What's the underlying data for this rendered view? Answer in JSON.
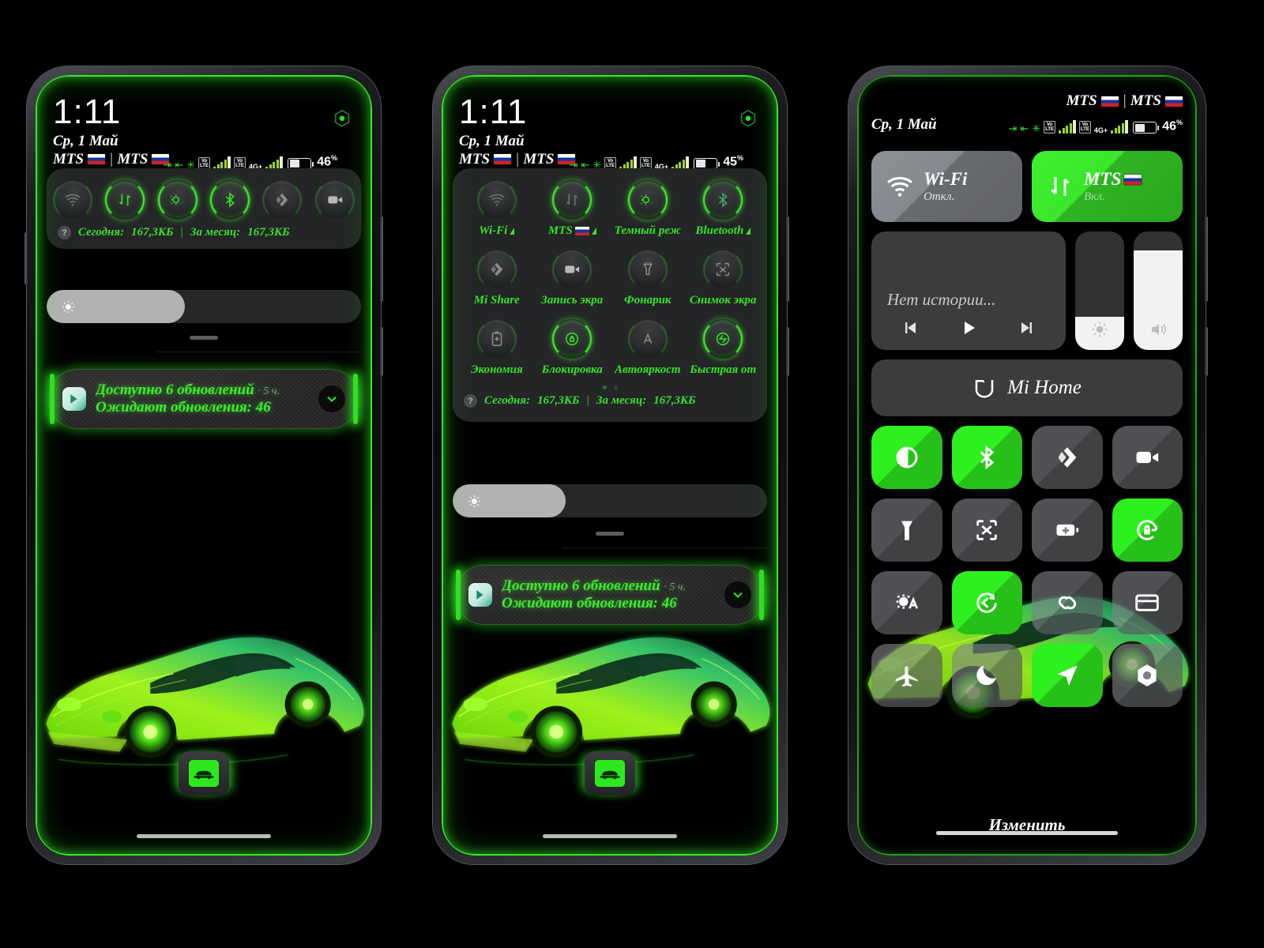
{
  "status_bar": {
    "time": "1:11",
    "date": "Ср, 1 Май",
    "carrier_1": "MTS",
    "carrier_2": "MTS",
    "carrier_separator": "|",
    "network_type": "4G+",
    "volte_label": "VoLTE",
    "battery_phone1": "46",
    "battery_phone2": "45",
    "battery_phone3": "46",
    "percent_symbol": "%"
  },
  "phone1": {
    "quick_toggles": [
      {
        "name": "wifi-toggle",
        "icon": "wifi-icon",
        "state": "off"
      },
      {
        "name": "mobile-data-toggle",
        "icon": "mobile-data-icon",
        "state": "on"
      },
      {
        "name": "dark-mode-toggle",
        "icon": "dark-mode-icon",
        "state": "on"
      },
      {
        "name": "bluetooth-toggle",
        "icon": "bluetooth-icon",
        "state": "on"
      },
      {
        "name": "mi-share-toggle",
        "icon": "mi-share-icon",
        "state": "off"
      },
      {
        "name": "screen-record-toggle",
        "icon": "screen-record-icon",
        "state": "off"
      }
    ],
    "data_usage": {
      "today_label": "Сегодня:",
      "today_value": "167,3КБ",
      "month_label": "За месяц:",
      "month_value": "167,3КБ",
      "help_glyph": "?"
    },
    "brightness_percent": 44,
    "notification": {
      "line1": "Доступно 6 обновлений",
      "age": "· 5 ч.",
      "line2": "Ожидают обновления: 46",
      "app_icon": "play-store-icon",
      "expand_icon": "chevron-down-icon"
    },
    "dock_app": "car-app-icon"
  },
  "phone2": {
    "tiles": [
      {
        "label": "Wi-Fi",
        "icon": "wifi-icon",
        "state": "off",
        "has_caret": true,
        "flag": false
      },
      {
        "label": "MTS",
        "icon": "mobile-data-icon",
        "state": "on",
        "has_caret": true,
        "flag": true
      },
      {
        "label": "Темный реж",
        "icon": "dark-mode-icon",
        "state": "on",
        "has_caret": false,
        "flag": false
      },
      {
        "label": "Bluetooth",
        "icon": "bluetooth-icon",
        "state": "on",
        "has_caret": true,
        "flag": false
      },
      {
        "label": "Mi Share",
        "icon": "mi-share-icon",
        "state": "off",
        "has_caret": false,
        "flag": false
      },
      {
        "label": "Запись экра",
        "icon": "screen-record-icon",
        "state": "off",
        "has_caret": false,
        "flag": false
      },
      {
        "label": "Фонарик",
        "icon": "flashlight-icon",
        "state": "off",
        "has_caret": false,
        "flag": false
      },
      {
        "label": "Снимок экра",
        "icon": "screenshot-icon",
        "state": "off",
        "has_caret": false,
        "flag": false
      },
      {
        "label": "Экономия",
        "icon": "battery-saver-icon",
        "state": "off",
        "has_caret": false,
        "flag": false
      },
      {
        "label": "Блокировка",
        "icon": "rotation-lock-icon",
        "state": "on",
        "has_caret": false,
        "flag": false
      },
      {
        "label": "Автояркост",
        "icon": "auto-brightness-icon",
        "state": "off",
        "has_caret": false,
        "flag": false
      },
      {
        "label": "Быстрая от",
        "icon": "quick-reply-icon",
        "state": "on",
        "has_caret": false,
        "flag": false
      }
    ],
    "page_dots": {
      "total": 2,
      "active": 0
    },
    "data_usage": {
      "today_label": "Сегодня:",
      "today_value": "167,3КБ",
      "month_label": "За месяц:",
      "month_value": "167,3КБ",
      "help_glyph": "?"
    },
    "brightness_percent": 36,
    "notification": {
      "line1": "Доступно 6 обновлений",
      "age": "· 5 ч.",
      "line2": "Ожидают обновления: 46",
      "app_icon": "play-store-icon",
      "expand_icon": "chevron-down-icon"
    },
    "dock_app": "car-app-icon"
  },
  "phone3": {
    "connectivity": [
      {
        "title": "Wi-Fi",
        "subtitle": "Откл.",
        "icon": "wifi-icon",
        "state": "off",
        "flag": false
      },
      {
        "title": "MTS",
        "subtitle": "Вкл.",
        "icon": "mobile-data-icon",
        "state": "on",
        "flag": true
      }
    ],
    "media": {
      "title": "Нет истории...",
      "prev_icon": "previous-track-icon",
      "play_icon": "play-icon",
      "next_icon": "next-track-icon"
    },
    "sliders": [
      {
        "name": "brightness-slider",
        "icon": "brightness-icon",
        "value": 28
      },
      {
        "name": "volume-slider",
        "icon": "volume-icon",
        "value": 84
      }
    ],
    "mi_home": {
      "label": "Mi Home",
      "icon": "mi-home-icon"
    },
    "tiles": [
      {
        "icon": "dark-mode-contrast-icon",
        "state": "on",
        "name": "dark-mode-tile"
      },
      {
        "icon": "bluetooth-icon",
        "state": "on",
        "name": "bluetooth-tile"
      },
      {
        "icon": "mi-share-icon",
        "state": "off",
        "name": "mi-share-tile"
      },
      {
        "icon": "screen-record-icon",
        "state": "off",
        "name": "screen-record-tile"
      },
      {
        "icon": "flashlight-icon",
        "state": "off",
        "name": "flashlight-tile"
      },
      {
        "icon": "screenshot-icon",
        "state": "off",
        "name": "screenshot-tile"
      },
      {
        "icon": "battery-saver-icon",
        "state": "off",
        "name": "battery-saver-tile"
      },
      {
        "icon": "rotation-lock-icon",
        "state": "on",
        "name": "rotation-lock-tile"
      },
      {
        "icon": "auto-brightness-icon",
        "state": "off",
        "name": "auto-brightness-tile"
      },
      {
        "icon": "quick-reply-icon",
        "state": "on",
        "name": "quick-reply-tile"
      },
      {
        "icon": "cast-link-icon",
        "state": "off",
        "name": "cast-tile"
      },
      {
        "icon": "wallet-icon",
        "state": "off",
        "name": "wallet-tile"
      },
      {
        "icon": "airplane-icon",
        "state": "off",
        "name": "airplane-tile"
      },
      {
        "icon": "do-not-disturb-icon",
        "state": "off",
        "name": "dnd-tile"
      },
      {
        "icon": "location-icon",
        "state": "on",
        "name": "location-tile"
      },
      {
        "icon": "settings-icon",
        "state": "off",
        "name": "settings-tile"
      }
    ],
    "edit_label": "Изменить"
  },
  "colors": {
    "accent_green": "#2ff01f",
    "neon_green": "#3dec2e",
    "panel_gray": "#242527",
    "tile_off": "#808388",
    "background": "#000000"
  }
}
